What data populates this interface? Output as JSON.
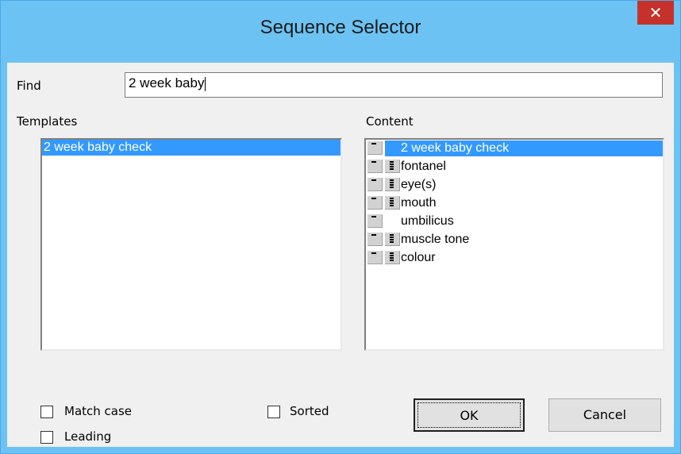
{
  "window": {
    "title": "Sequence Selector",
    "close_glyph": "✕"
  },
  "find": {
    "label": "Find",
    "value": "2 week baby"
  },
  "templates": {
    "label": "Templates",
    "items": [
      "2 week baby check"
    ]
  },
  "content": {
    "label": "Content",
    "items": [
      {
        "text": "2 week baby check",
        "selected": true,
        "icons": [
          "field-icon"
        ]
      },
      {
        "text": "fontanel",
        "selected": false,
        "icons": [
          "field-icon",
          "list-icon"
        ]
      },
      {
        "text": "eye(s)",
        "selected": false,
        "icons": [
          "field-icon",
          "list-icon"
        ]
      },
      {
        "text": "mouth",
        "selected": false,
        "icons": [
          "field-icon",
          "list-icon"
        ]
      },
      {
        "text": "umbilicus",
        "selected": false,
        "icons": [
          "field-icon"
        ]
      },
      {
        "text": "muscle tone",
        "selected": false,
        "icons": [
          "field-icon",
          "list-icon"
        ]
      },
      {
        "text": "colour",
        "selected": false,
        "icons": [
          "field-icon",
          "list-icon"
        ]
      }
    ]
  },
  "options": {
    "match_case": {
      "label": "Match case",
      "checked": false
    },
    "leading": {
      "label": "Leading",
      "checked": false
    },
    "sorted": {
      "label": "Sorted",
      "checked": false
    }
  },
  "buttons": {
    "ok": "OK",
    "cancel": "Cancel"
  },
  "colors": {
    "title_bar": "#6cc3f3",
    "close_button": "#c7312b",
    "selection": "#3399ff",
    "dialog_bg": "#f0f0f0"
  }
}
